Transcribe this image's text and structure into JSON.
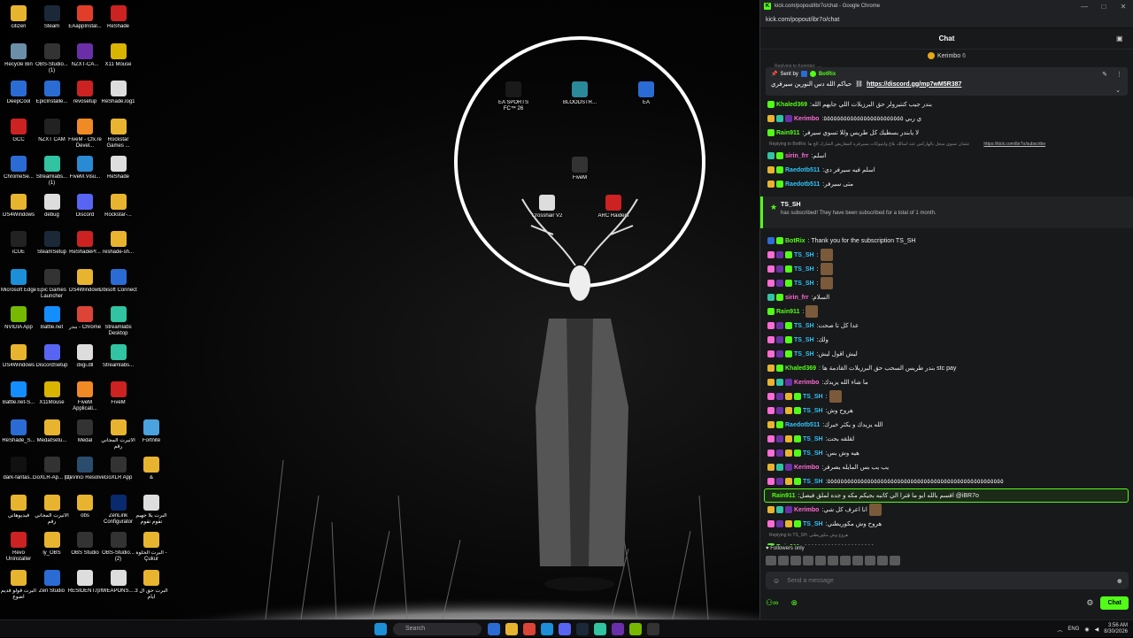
{
  "desktop_icons": [
    {
      "label": "citizen",
      "color": "#e8b430",
      "col": 0,
      "row": 0
    },
    {
      "label": "Steam",
      "color": "#1b2838",
      "col": 1,
      "row": 0
    },
    {
      "label": "EAappInstal...",
      "color": "#e23d28",
      "col": 2,
      "row": 0
    },
    {
      "label": "ReShade",
      "color": "#cc2222",
      "col": 3,
      "row": 0
    },
    {
      "label": "Recycle Bin",
      "color": "#6b8fa8",
      "col": 0,
      "row": 1
    },
    {
      "label": "OBS-Studio... (1)",
      "color": "#333",
      "col": 1,
      "row": 1
    },
    {
      "label": "NZXT-CA...",
      "color": "#6a2fa8",
      "col": 2,
      "row": 1
    },
    {
      "label": "X11 Mouse",
      "color": "#d9b400",
      "col": 3,
      "row": 1
    },
    {
      "label": "DeepCool",
      "color": "#2b6cd4",
      "col": 0,
      "row": 2
    },
    {
      "label": "EpicInstalle...",
      "color": "#2b6cd4",
      "col": 1,
      "row": 2
    },
    {
      "label": "revosetup",
      "color": "#c22",
      "col": 2,
      "row": 2
    },
    {
      "label": "ReShade.log1",
      "color": "#ddd",
      "col": 3,
      "row": 2
    },
    {
      "label": "GCC",
      "color": "#c22",
      "col": 0,
      "row": 3
    },
    {
      "label": "NZXT CAM",
      "color": "#222",
      "col": 1,
      "row": 3
    },
    {
      "label": "FiveM - Cfx.re Devel...",
      "color": "#f08a24",
      "col": 2,
      "row": 3
    },
    {
      "label": "Rockstar Games ...",
      "color": "#e8b430",
      "col": 3,
      "row": 3
    },
    {
      "label": "ChromeSe...",
      "color": "#2b6cd4",
      "col": 0,
      "row": 4
    },
    {
      "label": "Streamlabs... (1)",
      "color": "#31c3a2",
      "col": 1,
      "row": 4
    },
    {
      "label": "FiveM.Visu...",
      "color": "#2b8ad4",
      "col": 2,
      "row": 4
    },
    {
      "label": "ReShade",
      "color": "#ddd",
      "col": 3,
      "row": 4
    },
    {
      "label": "DS4Windows",
      "color": "#e8b430",
      "col": 0,
      "row": 5
    },
    {
      "label": "debug",
      "color": "#ddd",
      "col": 1,
      "row": 5
    },
    {
      "label": "Discord",
      "color": "#5865f2",
      "col": 2,
      "row": 5
    },
    {
      "label": "Rockstar-...",
      "color": "#e8b430",
      "col": 3,
      "row": 5
    },
    {
      "label": "iCUE",
      "color": "#222",
      "col": 0,
      "row": 6
    },
    {
      "label": "SteamSetup",
      "color": "#1b2838",
      "col": 1,
      "row": 6
    },
    {
      "label": "ReShadePr...",
      "color": "#c22",
      "col": 2,
      "row": 6
    },
    {
      "label": "reshade-sh...",
      "color": "#e8b430",
      "col": 3,
      "row": 6
    },
    {
      "label": "Microsoft Edge",
      "color": "#1c8fd8",
      "col": 0,
      "row": 7
    },
    {
      "label": "Epic Games Launcher",
      "color": "#333",
      "col": 1,
      "row": 7
    },
    {
      "label": "DS4Windows",
      "color": "#e8b430",
      "col": 2,
      "row": 7
    },
    {
      "label": "Ubisoft Connect",
      "color": "#2b6cd4",
      "col": 3,
      "row": 7
    },
    {
      "label": "NVIDIA App",
      "color": "#76b900",
      "col": 0,
      "row": 8
    },
    {
      "label": "Battle.net",
      "color": "#148eff",
      "col": 1,
      "row": 8
    },
    {
      "label": "بندر - Chrome",
      "color": "#db4437",
      "col": 2,
      "row": 8
    },
    {
      "label": "Streamlabs Desktop",
      "color": "#31c3a2",
      "col": 3,
      "row": 8
    },
    {
      "label": "DS4Windows",
      "color": "#e8b430",
      "col": 0,
      "row": 9
    },
    {
      "label": "DiscordSetup",
      "color": "#5865f2",
      "col": 1,
      "row": 9
    },
    {
      "label": "dxgi.dll",
      "color": "#ddd",
      "col": 2,
      "row": 9
    },
    {
      "label": "Streamlabs...",
      "color": "#31c3a2",
      "col": 3,
      "row": 9
    },
    {
      "label": "Battle.net-S...",
      "color": "#148eff",
      "col": 0,
      "row": 10
    },
    {
      "label": "X11Mouse",
      "color": "#d9b400",
      "col": 1,
      "row": 10
    },
    {
      "label": "FiveM Applicati...",
      "color": "#f08a24",
      "col": 2,
      "row": 10
    },
    {
      "label": "FiveM",
      "color": "#c22",
      "col": 3,
      "row": 10
    },
    {
      "label": "ReShade_S...",
      "color": "#2b6cd4",
      "col": 0,
      "row": 11
    },
    {
      "label": "MedalSetu...",
      "color": "#e8b430",
      "col": 1,
      "row": 11
    },
    {
      "label": "Medal",
      "color": "#333",
      "col": 2,
      "row": 11
    },
    {
      "label": "الأثيرت المجاني رقم",
      "color": "#e8b430",
      "col": 3,
      "row": 11
    },
    {
      "label": "Fortnite",
      "color": "#4aa3df",
      "col": 4,
      "row": 11
    },
    {
      "label": "dark-fantas...",
      "color": "#111",
      "col": 0,
      "row": 12
    },
    {
      "label": "GoXLR-Ap... (1)",
      "color": "#333",
      "col": 1,
      "row": 12
    },
    {
      "label": "DaVinci Resolve",
      "color": "#2a4d6e",
      "col": 2,
      "row": 12
    },
    {
      "label": "GoXLR App",
      "color": "#333",
      "col": 3,
      "row": 12
    },
    {
      "label": "&",
      "color": "#e8b430",
      "col": 4,
      "row": 12
    },
    {
      "label": "فيديوهاتي",
      "color": "#e8b430",
      "col": 0,
      "row": 13
    },
    {
      "label": "الأثيرت المجاني رقم",
      "color": "#e8b430",
      "col": 1,
      "row": 13
    },
    {
      "label": "obs",
      "color": "#e8b430",
      "col": 2,
      "row": 13
    },
    {
      "label": "ZenLink Configurator",
      "color": "#0a2a6e",
      "col": 3,
      "row": 13
    },
    {
      "label": "البرت يلا جهيم تقوم تقوم",
      "color": "#ddd",
      "col": 4,
      "row": 13
    },
    {
      "label": "Revo Uninstaller",
      "color": "#c22",
      "col": 0,
      "row": 14
    },
    {
      "label": "ly_OBS",
      "color": "#e8b430",
      "col": 1,
      "row": 14
    },
    {
      "label": "OBS Studio",
      "color": "#333",
      "col": 2,
      "row": 14
    },
    {
      "label": "OBS-Studio... (2)",
      "color": "#333",
      "col": 3,
      "row": 14
    },
    {
      "label": "البرت الحلوة - Çukur",
      "color": "#e8b430",
      "col": 4,
      "row": 14
    },
    {
      "label": "البرت قولو قديم اضوع",
      "color": "#e8b430",
      "col": 0,
      "row": 15
    },
    {
      "label": "Zen Studio",
      "color": "#2b6cd4",
      "col": 1,
      "row": 15
    },
    {
      "label": "RESIDENT.rpf",
      "color": "#ddd",
      "col": 2,
      "row": 15
    },
    {
      "label": "WEAPONS....",
      "color": "#ddd",
      "col": 3,
      "row": 15
    },
    {
      "label": "البرت حق ال 3 ايام",
      "color": "#e8b430",
      "col": 4,
      "row": 15
    }
  ],
  "circle_icons": [
    {
      "label": "EA SPORTS FC™ 26",
      "color": "#1a1a1a"
    },
    {
      "label": "BLOODSTR...",
      "color": "#2a8a9a"
    },
    {
      "label": "EA",
      "color": "#2b6cd4"
    },
    {
      "label": "FiveM",
      "color": "#333"
    },
    {
      "label": "Crosshair V2",
      "color": "#ddd"
    },
    {
      "label": "ARC Raiders",
      "color": "#c22"
    }
  ],
  "taskbar": {
    "search_label": "Search",
    "lang": "ENG",
    "time": "3:56 AM",
    "date": "8/30/2026",
    "app_colors": [
      "#2b6cd4",
      "#e8b430",
      "#db4437",
      "#1c8fd8",
      "#5865f2",
      "#1b2838",
      "#31c3a2",
      "#6a2fa8",
      "#76b900",
      "#333"
    ]
  },
  "browser": {
    "window_title": "kick.com/popout/ibr7o/chat - Google Chrome",
    "favicon": "K",
    "url": "kick.com/popout/ibr7o/chat"
  },
  "chat": {
    "title": "Chat",
    "pinned_user": "Kerimbo",
    "pinned_user_count": "6",
    "replying_top": "Replying to Kerimbo: ....",
    "pinned": {
      "sent_by": "Sent by",
      "bot_name": "BotRix",
      "text": "حياكم الله دس النورين سيرفري",
      "link": "https://discord.gg/mp7wM5R387"
    },
    "messages": [
      {
        "type": "msg",
        "user": "Khaled369",
        "color": "#53fc18",
        "badges": [
          "#53fc18"
        ],
        "text": ":بندر جيب كنتيرولر حق البرزيلات اللي جايهم الله"
      },
      {
        "type": "msg",
        "user": "Kerimbo",
        "color": "#ff6bd5",
        "badges": [
          "#e8b430",
          "#31c3a2",
          "#6a2fa8"
        ],
        "text": ":ي ربي ٥٥٥٥٥٥٥٥٥٥٥٥٥٥٥٥٥٥٥٥٥٥٥٥"
      },
      {
        "type": "msg",
        "user": "Rain911",
        "color": "#53fc18",
        "badges": [
          "#53fc18"
        ],
        "text": ":لا يابندر بسطيك كل طريس وللا تسوي سيرفر"
      },
      {
        "type": "reply",
        "text": "Replying to BotRix: عشان تسوي سجل بالهاركس عند اسالك بلاغ وابتيوكات بسيرفره المفاريض الشارك الخ ها",
        "link": "https://kick.com/ibr7o/subscribe"
      },
      {
        "type": "msg",
        "user": "sirin_frr",
        "color": "#ff6bd5",
        "badges": [
          "#31c3a2",
          "#53fc18"
        ],
        "text": ":اسلم"
      },
      {
        "type": "msg",
        "user": "Raedotb511",
        "color": "#31c3f5",
        "badges": [
          "#e8b430",
          "#53fc18"
        ],
        "text": ":اسلم فيه سيرفر دي"
      },
      {
        "type": "msg",
        "user": "Raedotb511",
        "color": "#31c3f5",
        "badges": [
          "#e8b430",
          "#53fc18"
        ],
        "text": ":متى سيرفر"
      },
      {
        "type": "sub",
        "user": "TS_SH",
        "text": "has subscribed! They have been subscribed for a total of 1 month."
      },
      {
        "type": "msg",
        "user": "BotRix",
        "color": "#53fc18",
        "badges": [
          "#2b6cd4",
          "#53fc18"
        ],
        "text": ": Thank you for the subscription TS_SH"
      },
      {
        "type": "msg",
        "user": "TS_SH",
        "color": "#31c3f5",
        "badges": [
          "#ff6bd5",
          "#6a2fa8",
          "#53fc18"
        ],
        "text": ":",
        "emote": true
      },
      {
        "type": "msg",
        "user": "TS_SH",
        "color": "#31c3f5",
        "badges": [
          "#ff6bd5",
          "#6a2fa8",
          "#53fc18"
        ],
        "text": ":",
        "emote": true
      },
      {
        "type": "msg",
        "user": "TS_SH",
        "color": "#31c3f5",
        "badges": [
          "#ff6bd5",
          "#6a2fa8",
          "#53fc18"
        ],
        "text": ":",
        "emote": true
      },
      {
        "type": "msg",
        "user": "sirin_frr",
        "color": "#ff6bd5",
        "badges": [
          "#31c3a2",
          "#53fc18"
        ],
        "text": ":السلام"
      },
      {
        "type": "msg",
        "user": "Rain911",
        "color": "#53fc18",
        "badges": [
          "#53fc18"
        ],
        "text": ":",
        "emote": true
      },
      {
        "type": "msg",
        "user": "TS_SH",
        "color": "#31c3f5",
        "badges": [
          "#ff6bd5",
          "#6a2fa8",
          "#53fc18"
        ],
        "text": ":عدا كل تا صحت"
      },
      {
        "type": "msg",
        "user": "TS_SH",
        "color": "#31c3f5",
        "badges": [
          "#ff6bd5",
          "#6a2fa8",
          "#53fc18"
        ],
        "text": ":ولك"
      },
      {
        "type": "msg",
        "user": "TS_SH",
        "color": "#31c3f5",
        "badges": [
          "#ff6bd5",
          "#6a2fa8",
          "#53fc18"
        ],
        "text": ":ليش اقول ليش"
      },
      {
        "type": "msg",
        "user": "Khaled369",
        "color": "#53fc18",
        "badges": [
          "#e8b430",
          "#53fc18"
        ],
        "text": ": بندر طريس السحب حق البرزيلات القادمة ها stc pay"
      },
      {
        "type": "msg",
        "user": "Kerimbo",
        "color": "#ff6bd5",
        "badges": [
          "#e8b430",
          "#31c3a2",
          "#6a2fa8"
        ],
        "text": ":ما شاء الله يزيدك"
      },
      {
        "type": "msg",
        "user": "TS_SH",
        "color": "#31c3f5",
        "badges": [
          "#ff6bd5",
          "#6a2fa8",
          "#e8b430",
          "#53fc18"
        ],
        "text": ":",
        "emote": true
      },
      {
        "type": "msg",
        "user": "TS_SH",
        "color": "#31c3f5",
        "badges": [
          "#ff6bd5",
          "#6a2fa8",
          "#e8b430",
          "#53fc18"
        ],
        "text": ":هروح وش"
      },
      {
        "type": "msg",
        "user": "Raedotb511",
        "color": "#31c3f5",
        "badges": [
          "#e8b430",
          "#53fc18"
        ],
        "text": ":الله يزيدك و يكثر خيرك"
      },
      {
        "type": "msg",
        "user": "TS_SH",
        "color": "#31c3f5",
        "badges": [
          "#ff6bd5",
          "#6a2fa8",
          "#e8b430",
          "#53fc18"
        ],
        "text": ":لقلقه بحت"
      },
      {
        "type": "msg",
        "user": "TS_SH",
        "color": "#31c3f5",
        "badges": [
          "#ff6bd5",
          "#6a2fa8",
          "#e8b430",
          "#53fc18"
        ],
        "text": ":هيه وش بس"
      },
      {
        "type": "msg",
        "user": "Kerimbo",
        "color": "#ff6bd5",
        "badges": [
          "#e8b430",
          "#31c3a2",
          "#6a2fa8"
        ],
        "text": ":يب يب بس المايله يصرفر"
      },
      {
        "type": "msg",
        "user": "TS_SH",
        "color": "#31c3f5",
        "badges": [
          "#ff6bd5",
          "#6a2fa8",
          "#e8b430",
          "#53fc18"
        ],
        "text": ":٥٥٥٥٥٥٥٥٥٥٥٥٥٥٥٥٥٥٥٥٥٥٥٥٥٥٥٥٥٥٥٥٥٥٥٥٥٥٥٥٥٥٥٥٥٥٥٥٥٥٥٥٥"
      },
      {
        "type": "hl",
        "user": "Rain911",
        "color": "#53fc18",
        "badges": [],
        "text": ":اقسم بالله ابو ما قترا الي كاتبه بجيكم مكه و جده لملق فيصل @iBR7o"
      },
      {
        "type": "msg",
        "user": "Kerimbo",
        "color": "#ff6bd5",
        "badges": [
          "#e8b430",
          "#31c3a2",
          "#6a2fa8"
        ],
        "text": ":انا اعرف كل شي",
        "emote": true
      },
      {
        "type": "msg",
        "user": "TS_SH",
        "color": "#31c3f5",
        "badges": [
          "#ff6bd5",
          "#6a2fa8",
          "#e8b430",
          "#53fc18"
        ],
        "text": ":هروح وش مكوريطني"
      },
      {
        "type": "reply",
        "text": "Replying to TS_SH: هروح وش مكوريطني",
        "link": ""
      },
      {
        "type": "msg",
        "user": "Rain911",
        "color": "#53fc18",
        "badges": [
          "#53fc18"
        ],
        "text": ":٥٥٥٥٥٥٥٥٥٥٥٥٥٥٥٥٥٥٥٥٥"
      }
    ],
    "followers_only": "Followers only",
    "send_placeholder": "Send a message",
    "chat_button": "Chat"
  }
}
